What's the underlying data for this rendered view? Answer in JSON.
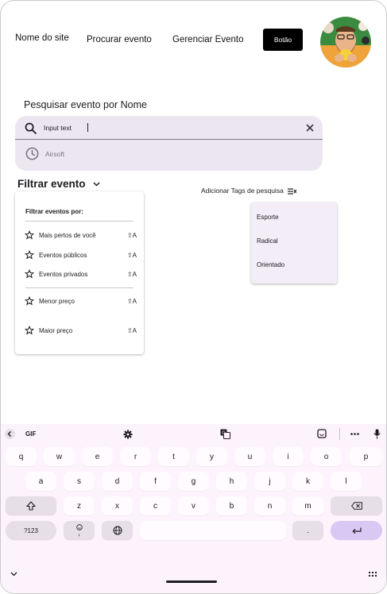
{
  "header": {
    "site_name": "Nome do site",
    "nav_search": "Procurar evento",
    "nav_manage": "Gerenciar Evento",
    "button_label": "Botão"
  },
  "search": {
    "title": "Pesquisar evento por Nome",
    "input_value": "Input text",
    "suggestions": [
      {
        "label": "Airsoft",
        "icon": "history-icon"
      }
    ]
  },
  "filter": {
    "title": "Filtrar evento",
    "heading": "Filtrar eventos por:",
    "items": [
      {
        "label": "Mais pertos de você",
        "shortcut": "⇧A"
      },
      {
        "label": "Eventos públicos",
        "shortcut": "⇧A"
      },
      {
        "label": "Eventos privados",
        "shortcut": "⇧A"
      },
      {
        "label": "Menor preço",
        "shortcut": "⇧A"
      },
      {
        "label": "Maior preço",
        "shortcut": "⇧A"
      }
    ]
  },
  "tags": {
    "trigger_label": "Adicionar Tags de pesquisa",
    "items": [
      "Esporte",
      "Radical",
      "Orientado"
    ]
  },
  "keyboard": {
    "gif_label": "GIF",
    "row1": [
      "q",
      "w",
      "e",
      "r",
      "t",
      "y",
      "u",
      "i",
      "o",
      "p"
    ],
    "row2": [
      "a",
      "s",
      "d",
      "f",
      "g",
      "h",
      "j",
      "k",
      "l"
    ],
    "row3": [
      "z",
      "x",
      "c",
      "v",
      "b",
      "n",
      "m"
    ],
    "symbols_label": "?123",
    "comma_label": ",",
    "period_label": "."
  },
  "colors": {
    "search_surface": "#ece6f0",
    "menu_surface": "#f3edf7",
    "keyboard_bg": "#fcf3fc",
    "enter_key": "#d8c9f4",
    "primary_button": "#000000"
  }
}
